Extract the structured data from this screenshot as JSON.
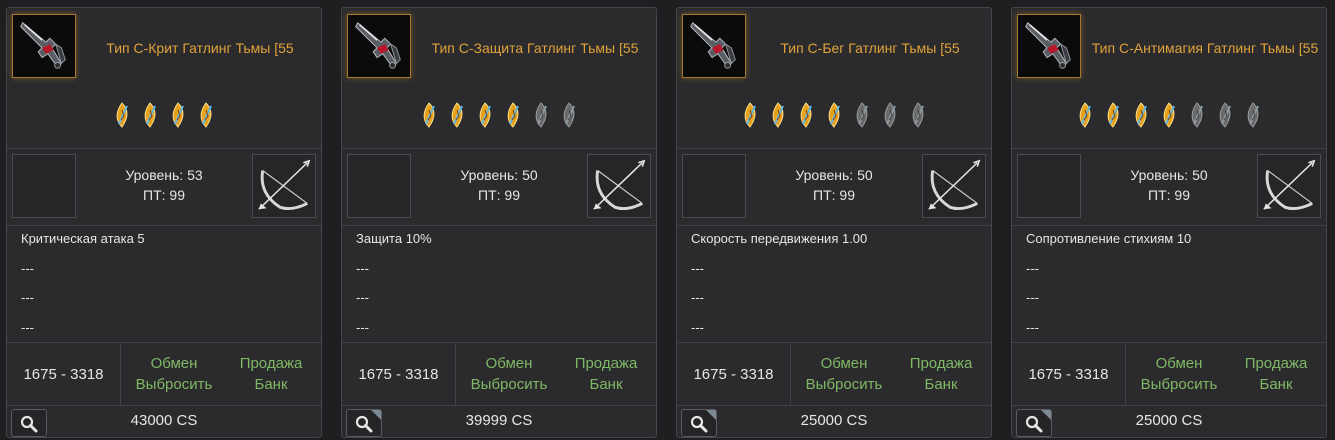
{
  "colors": {
    "title": "#e0a23a",
    "link": "#7fb865",
    "gem_active": "#e6a21e",
    "gem_inactive": "#6a6a6a"
  },
  "cards": [
    {
      "title": "Тип С-Крит Гатлинг Тьмы [55",
      "gems_total": 4,
      "gems_active": 4,
      "level": "Уровень: 53",
      "pt": "ПТ: 99",
      "attrs": [
        "Критическая атака 5",
        "---",
        "---",
        "---"
      ],
      "range": "1675 - 3318",
      "actions": {
        "exchange": "Обмен",
        "drop": "Выбросить",
        "sell": "Продажа",
        "bank": "Банк"
      },
      "price": "43000 CS"
    },
    {
      "title": "Тип С-Защита Гатлинг Тьмы [55",
      "gems_total": 6,
      "gems_active": 4,
      "level": "Уровень: 50",
      "pt": "ПТ: 99",
      "attrs": [
        "Защита 10%",
        "---",
        "---",
        "---"
      ],
      "range": "1675 - 3318",
      "actions": {
        "exchange": "Обмен",
        "drop": "Выбросить",
        "sell": "Продажа",
        "bank": "Банк"
      },
      "price": "39999 CS"
    },
    {
      "title": "Тип С-Бег Гатлинг Тьмы [55",
      "gems_total": 7,
      "gems_active": 4,
      "level": "Уровень: 50",
      "pt": "ПТ: 99",
      "attrs": [
        "Скорость передвижения 1.00",
        "---",
        "---",
        "---"
      ],
      "range": "1675 - 3318",
      "actions": {
        "exchange": "Обмен",
        "drop": "Выбросить",
        "sell": "Продажа",
        "bank": "Банк"
      },
      "price": "25000 CS"
    },
    {
      "title": "Тип С-Антимагия Гатлинг Тьмы [55",
      "gems_total": 7,
      "gems_active": 4,
      "level": "Уровень: 50",
      "pt": "ПТ: 99",
      "attrs": [
        "Сопротивление стихиям 10",
        "---",
        "---",
        "---"
      ],
      "range": "1675 - 3318",
      "actions": {
        "exchange": "Обмен",
        "drop": "Выбросить",
        "sell": "Продажа",
        "bank": "Банк"
      },
      "price": "25000 CS"
    }
  ]
}
